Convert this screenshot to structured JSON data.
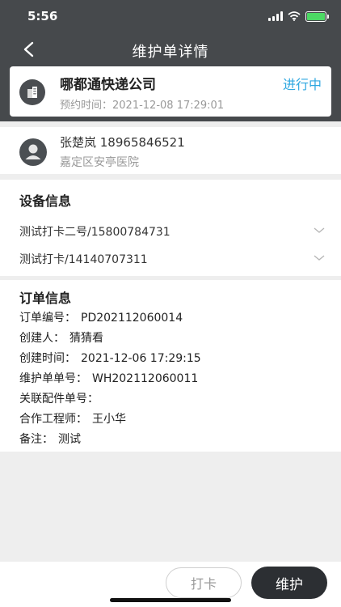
{
  "status_bar": {
    "time": "5:56"
  },
  "nav": {
    "title": "维护单详情"
  },
  "company": {
    "name": "哪都通快递公司",
    "appointment_label": "预约时间：",
    "appointment_time": "2021-12-08 17:29:01",
    "status": "进行中"
  },
  "contact": {
    "name_phone": "张楚岚 18965846521",
    "address": "嘉定区安亭医院"
  },
  "devices": {
    "title": "设备信息",
    "items": [
      {
        "label": "测试打卡二号/15800784731"
      },
      {
        "label": "测试打卡/14140707311"
      }
    ]
  },
  "order": {
    "title": "订单信息",
    "fields": [
      {
        "key": "订单编号：",
        "value": "PD202112060014"
      },
      {
        "key": "创建人：",
        "value": "猜猜看"
      },
      {
        "key": "创建时间：",
        "value": "2021-12-06 17:29:15"
      },
      {
        "key": "维护单单号：",
        "value": "WH202112060011"
      },
      {
        "key": "关联配件单号：",
        "value": ""
      },
      {
        "key": "合作工程师：",
        "value": "王小华"
      },
      {
        "key": "备注：",
        "value": "测试"
      }
    ]
  },
  "actions": {
    "checkin_label": "打卡",
    "maintain_label": "维护"
  },
  "colors": {
    "header_bg": "#46494c",
    "status_blue": "#2ea7e0",
    "primary_button": "#2c2f33"
  }
}
